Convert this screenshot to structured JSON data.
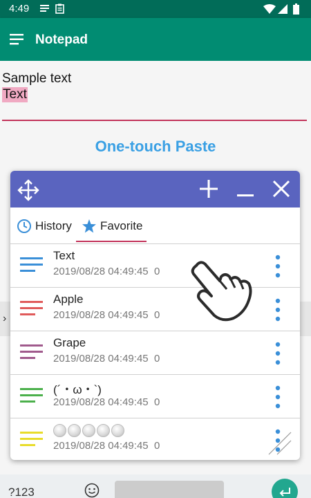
{
  "status_bar": {
    "time": "4:49",
    "icons": [
      "notification-lines-icon",
      "clipboard-icon",
      "wifi-icon",
      "signal-icon",
      "battery-icon"
    ]
  },
  "app_bar": {
    "title": "Notepad",
    "menu_icon": "hamburger-menu-icon"
  },
  "editor": {
    "line1": "Sample text",
    "line2": "Text"
  },
  "overlay_title": "One-touch Paste",
  "panel": {
    "header_icons": [
      "move-icon",
      "plus-icon",
      "minimize-icon",
      "close-icon"
    ],
    "tabs": [
      {
        "label": "History",
        "icon": "clock-icon"
      },
      {
        "label": "Favorite",
        "icon": "star-icon"
      }
    ],
    "selected_tab": "Favorite",
    "items": [
      {
        "name": "Text",
        "date": "2019/08/28 04:49:45",
        "count": "0",
        "color": "#3a8fd8"
      },
      {
        "name": "Apple",
        "date": "2019/08/28 04:49:45",
        "count": "0",
        "color": "#e05a5a"
      },
      {
        "name": "Grape",
        "date": "2019/08/28 04:49:45",
        "count": "0",
        "color": "#a05a8c"
      },
      {
        "name": "(´・ω・`)",
        "date": "2019/08/28 04:49:45",
        "count": "0",
        "color": "#4bb04b"
      },
      {
        "name": "",
        "date": "2019/08/28 04:49:45",
        "count": "0",
        "color": "#e8dc2a"
      }
    ]
  },
  "keyboard": {
    "numbers_key": "?123",
    "emoji_icon": "emoji-icon",
    "enter_icon": "enter-icon"
  },
  "colors": {
    "status_bar": "#016c58",
    "app_bar": "#018c72",
    "panel_header": "#5a64bf",
    "accent_underline": "#c2335a",
    "overlay_title": "#3aa0e4"
  }
}
